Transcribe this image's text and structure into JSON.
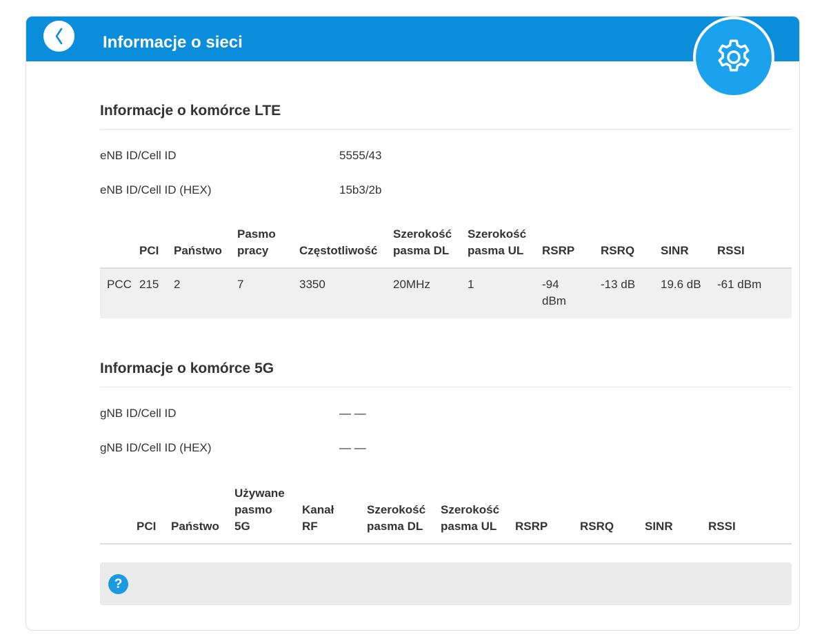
{
  "header": {
    "title": "Informacje o sieci"
  },
  "icons": {
    "back": "chevron-left-icon",
    "settings": "gear-icon",
    "help": "help-icon"
  },
  "colors": {
    "header_bg": "#0a8edb",
    "settings_bg": "#1aa3ec",
    "help_icon": "#1a9be0"
  },
  "lte": {
    "title": "Informacje o komórce LTE",
    "info": [
      {
        "label": "eNB ID/Cell ID",
        "value": "5555/43"
      },
      {
        "label": "eNB ID/Cell ID (HEX)",
        "value": "15b3/2b"
      }
    ],
    "headers": [
      "",
      "PCI",
      "Państwo",
      "Pasmo pracy",
      "Częstotliwość",
      "Szerokość pasma DL",
      "Szerokość pasma UL",
      "RSRP",
      "RSRQ",
      "SINR",
      "RSSI"
    ],
    "rows": [
      [
        "PCC",
        "215",
        "2",
        "7",
        "3350",
        "20MHz",
        "1",
        "-94 dBm",
        "-13 dB",
        "19.6 dB",
        "-61 dBm"
      ]
    ]
  },
  "nr": {
    "title": "Informacje o komórce 5G",
    "info": [
      {
        "label": "gNB ID/Cell ID",
        "value": "— —"
      },
      {
        "label": "gNB ID/Cell ID (HEX)",
        "value": "— —"
      }
    ],
    "headers": [
      "",
      "PCI",
      "Państwo",
      "Używane pasmo 5G",
      "Kanał RF",
      "Szerokość pasma DL",
      "Szerokość pasma UL",
      "RSRP",
      "RSRQ",
      "SINR",
      "RSSI"
    ]
  },
  "help": {
    "icon_glyph": "?"
  }
}
